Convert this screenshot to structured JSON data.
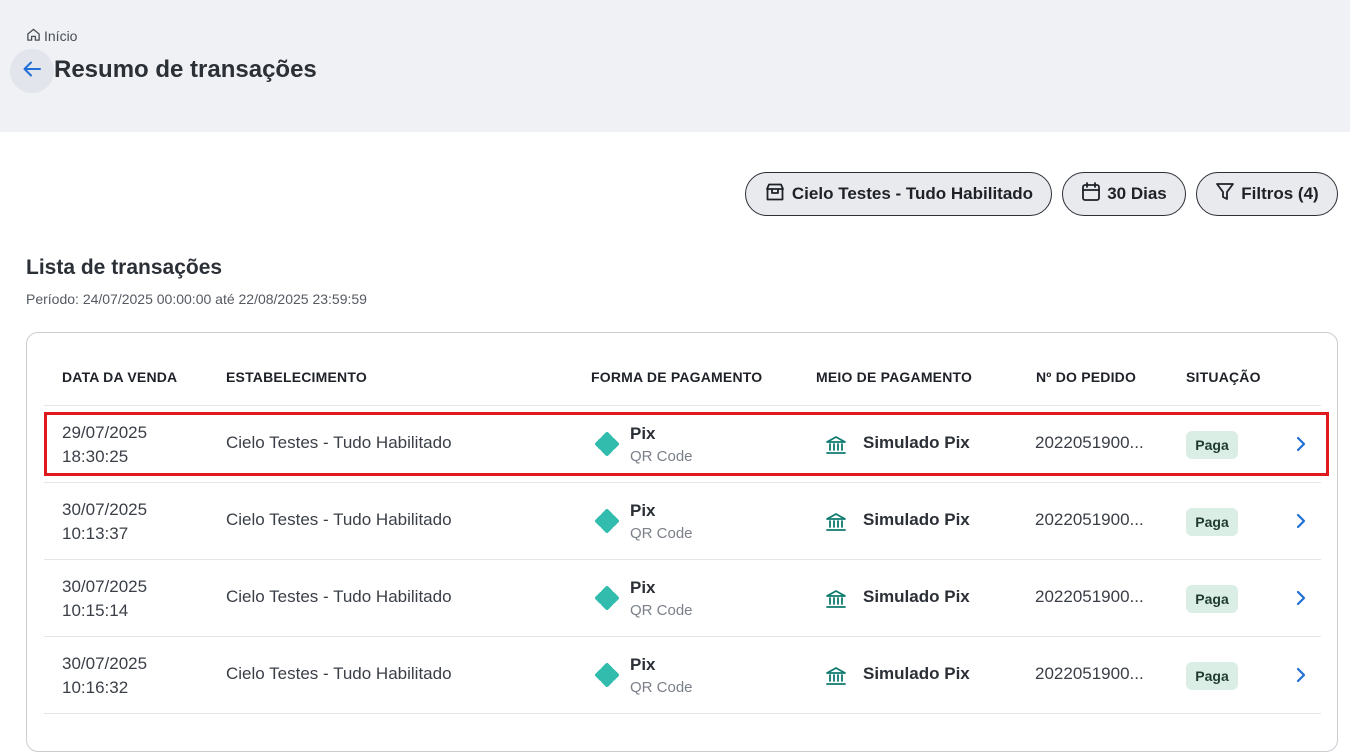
{
  "breadcrumb": {
    "label": "Início"
  },
  "page": {
    "title": "Resumo de transações"
  },
  "filters": {
    "merchant": "Cielo Testes - Tudo Habilitado",
    "period": "30 Dias",
    "filters": "Filtros (4)"
  },
  "list": {
    "title": "Lista de transações",
    "period": "Período: 24/07/2025 00:00:00 até 22/08/2025 23:59:59"
  },
  "table": {
    "headers": [
      "DATA DA VENDA",
      "ESTABELECIMENTO",
      "FORMA DE PAGAMENTO",
      "MEIO DE PAGAMENTO",
      "Nº DO PEDIDO",
      "SITUAÇÃO"
    ],
    "rows": [
      {
        "date": "29/07/2025",
        "time": "18:30:25",
        "establishment": "Cielo Testes - Tudo Habilitado",
        "payment_form": "Pix",
        "payment_sub": "QR Code",
        "payment_means": "Simulado Pix",
        "order": "2022051900...",
        "status": "Paga"
      },
      {
        "date": "30/07/2025",
        "time": "10:13:37",
        "establishment": "Cielo Testes - Tudo Habilitado",
        "payment_form": "Pix",
        "payment_sub": "QR Code",
        "payment_means": "Simulado Pix",
        "order": "2022051900...",
        "status": "Paga"
      },
      {
        "date": "30/07/2025",
        "time": "10:15:14",
        "establishment": "Cielo Testes - Tudo Habilitado",
        "payment_form": "Pix",
        "payment_sub": "QR Code",
        "payment_means": "Simulado Pix",
        "order": "2022051900...",
        "status": "Paga"
      },
      {
        "date": "30/07/2025",
        "time": "10:16:32",
        "establishment": "Cielo Testes - Tudo Habilitado",
        "payment_form": "Pix",
        "payment_sub": "QR Code",
        "payment_means": "Simulado Pix",
        "order": "2022051900...",
        "status": "Paga"
      }
    ]
  },
  "colors": {
    "accent_blue": "#1f6fd6",
    "pix_teal": "#32bcad",
    "bank_teal": "#0f7a6e",
    "highlight_red": "#e0191f",
    "badge_bg": "#dbeee6"
  },
  "icons": {
    "breadcrumb": "home-icon",
    "back": "arrow-left-icon",
    "merchant": "store-icon",
    "period": "calendar-icon",
    "filters": "filter-icon",
    "payment_form": "pix-icon",
    "payment_means": "bank-icon",
    "row_action": "chevron-right-icon"
  }
}
